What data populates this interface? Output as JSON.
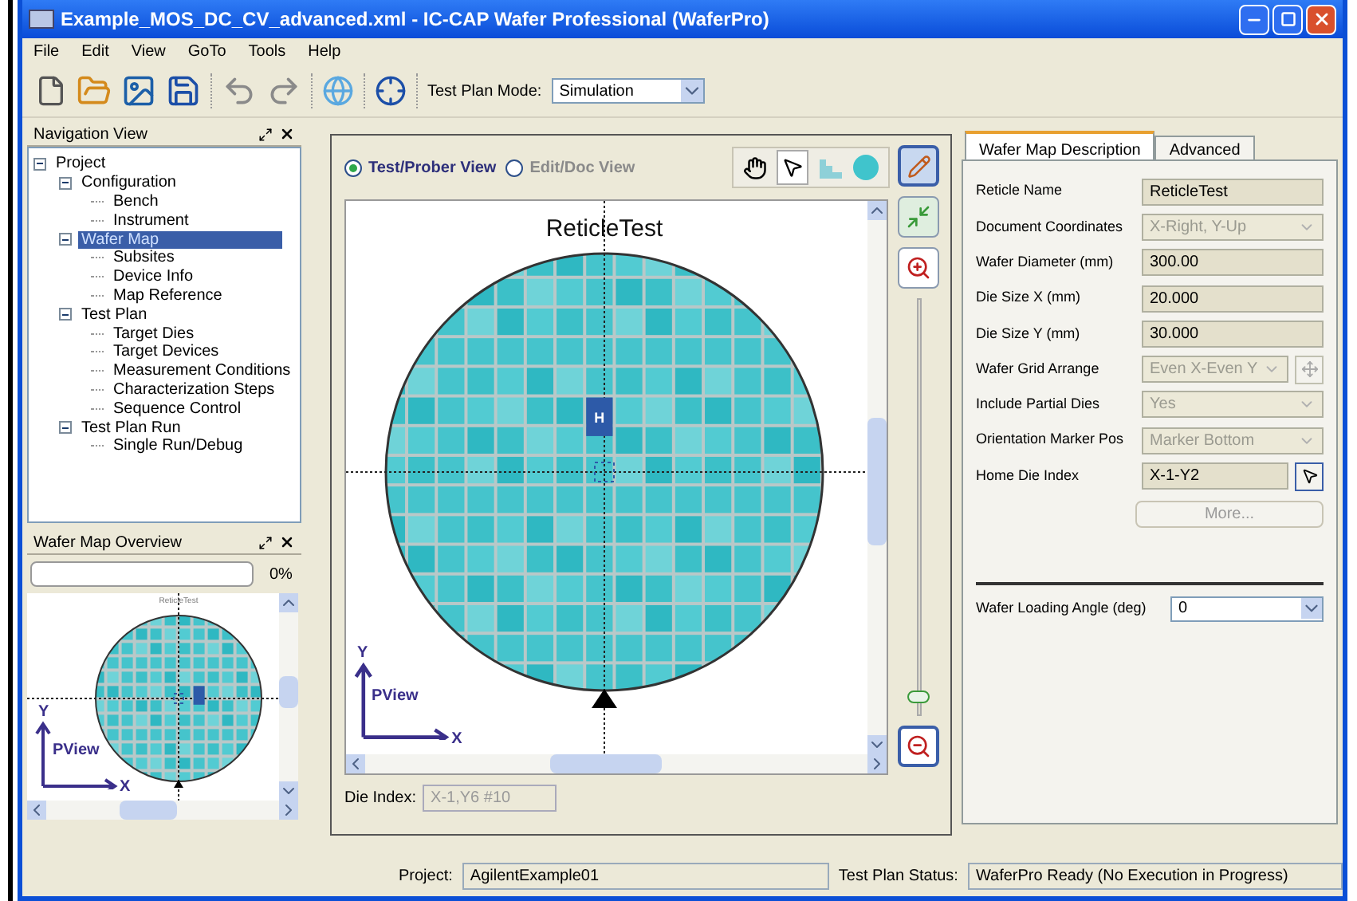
{
  "window": {
    "title": "Example_MOS_DC_CV_advanced.xml - IC-CAP Wafer Professional (WaferPro)"
  },
  "menu": [
    "File",
    "Edit",
    "View",
    "GoTo",
    "Tools",
    "Help"
  ],
  "toolbar": {
    "mode_label": "Test Plan Mode:",
    "mode_value": "Simulation"
  },
  "navigation_view": {
    "title": "Navigation View",
    "tree": [
      {
        "label": "Project",
        "selected": false,
        "children": [
          {
            "label": "Configuration",
            "selected": false,
            "children": [
              {
                "label": "Bench",
                "selected": false
              },
              {
                "label": "Instrument",
                "selected": false
              }
            ]
          },
          {
            "label": "Wafer Map",
            "selected": true,
            "children": [
              {
                "label": "Subsites",
                "selected": false
              },
              {
                "label": "Device Info",
                "selected": false
              },
              {
                "label": "Map Reference",
                "selected": false
              }
            ]
          },
          {
            "label": "Test Plan",
            "selected": false,
            "children": [
              {
                "label": "Target Dies",
                "selected": false
              },
              {
                "label": "Target Devices",
                "selected": false
              },
              {
                "label": "Measurement Conditions",
                "selected": false
              },
              {
                "label": "Characterization Steps",
                "selected": false
              },
              {
                "label": "Sequence Control",
                "selected": false
              }
            ]
          },
          {
            "label": "Test Plan Run",
            "selected": false,
            "children": [
              {
                "label": "Single Run/Debug",
                "selected": false
              }
            ]
          }
        ]
      }
    ]
  },
  "overview": {
    "title": "Wafer Map Overview",
    "progress": {
      "level": 0,
      "text": "0%"
    },
    "map_title": "ReticleTest",
    "axis_y": "Y",
    "axis_x": "X",
    "axis_label": "PView"
  },
  "view": {
    "radios": [
      {
        "label": "Test/Prober View",
        "selected": true
      },
      {
        "label": "Edit/Doc View",
        "selected": false
      }
    ],
    "map_title": "ReticleTest",
    "home_label": "H",
    "axis_y": "Y",
    "axis_x": "X",
    "axis_label": "PView",
    "die_index": {
      "label": "Die Index:",
      "value": "X-1,Y6 #10"
    },
    "zoom": {
      "level": 0.03
    }
  },
  "properties": {
    "tabs": [
      {
        "label": "Wafer Map Description",
        "selected": true
      },
      {
        "label": "Advanced",
        "selected": false
      }
    ],
    "fields": [
      {
        "label": "Reticle Name",
        "value": "ReticleTest",
        "kind": "text",
        "disabled": false
      },
      {
        "label": "Document Coordinates",
        "value": "X-Right, Y-Up",
        "kind": "select",
        "disabled": true
      },
      {
        "label": "Wafer Diameter (mm)",
        "value": "300.00",
        "kind": "text",
        "disabled": false
      },
      {
        "label": "Die Size X (mm)",
        "value": "20.000",
        "kind": "text",
        "disabled": false
      },
      {
        "label": "Die Size Y (mm)",
        "value": "30.000",
        "kind": "text",
        "disabled": false
      },
      {
        "label": "Wafer Grid Arrange",
        "value": "Even X-Even Y",
        "kind": "select_button",
        "disabled": true
      },
      {
        "label": "Include Partial Dies",
        "value": "Yes",
        "kind": "select",
        "disabled": true
      },
      {
        "label": "Orientation Marker Pos",
        "value": "Marker Bottom",
        "kind": "select",
        "disabled": true
      },
      {
        "label": "Home Die Index",
        "value": "X-1-Y2",
        "kind": "text_button",
        "disabled": false
      }
    ],
    "more_button": {
      "label": "More...",
      "disabled": true
    },
    "loading_angle": {
      "label": "Wafer Loading Angle (deg)",
      "value": "0"
    }
  },
  "status_bar": {
    "project_label": "Project:",
    "project_value": "AgilentExample01",
    "status_label": "Test Plan Status:",
    "status_value": "WaferPro Ready (No Execution in Progress)"
  }
}
